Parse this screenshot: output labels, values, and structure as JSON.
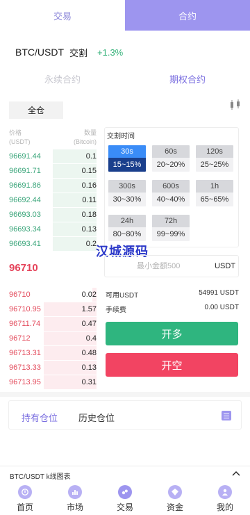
{
  "top_tabs": {
    "exchange": "交易",
    "contract": "合约"
  },
  "pair": {
    "name": "BTC/USDT",
    "type": "交割",
    "change": "+1.3%"
  },
  "contract_tabs": {
    "perpetual": "永续合约",
    "options": "期权合约"
  },
  "all_positions_label": "全仓",
  "orderbook": {
    "price_header": "价格",
    "price_unit": "(USDT)",
    "qty_header": "数量",
    "qty_unit": "(Bitcoin)",
    "buy_rows": [
      {
        "price": "96691.44",
        "qty": "0.1",
        "depth": 0.5
      },
      {
        "price": "96691.71",
        "qty": "0.15",
        "depth": 0.5
      },
      {
        "price": "96691.86",
        "qty": "0.16",
        "depth": 0.5
      },
      {
        "price": "96692.44",
        "qty": "0.11",
        "depth": 0.5
      },
      {
        "price": "96693.03",
        "qty": "0.18",
        "depth": 0.5
      },
      {
        "price": "96693.34",
        "qty": "0.13",
        "depth": 0.5
      },
      {
        "price": "96693.41",
        "qty": "0.2",
        "depth": 0.5
      }
    ],
    "last_price": "96710",
    "sell_rows": [
      {
        "price": "96710",
        "qty": "0.02",
        "depth": 0.05
      },
      {
        "price": "96710.95",
        "qty": "1.57",
        "depth": 0.6
      },
      {
        "price": "96711.74",
        "qty": "0.47",
        "depth": 0.6
      },
      {
        "price": "96712",
        "qty": "0.4",
        "depth": 0.6
      },
      {
        "price": "96713.31",
        "qty": "0.48",
        "depth": 0.6
      },
      {
        "price": "96713.33",
        "qty": "0.13",
        "depth": 0.6
      },
      {
        "price": "96713.95",
        "qty": "0.31",
        "depth": 0.6
      }
    ]
  },
  "delivery": {
    "title": "交割时间",
    "options": [
      {
        "time": "30s",
        "range": "15~15%",
        "selected": true
      },
      {
        "time": "60s",
        "range": "20~20%",
        "selected": false
      },
      {
        "time": "120s",
        "range": "25~25%",
        "selected": false
      },
      {
        "time": "300s",
        "range": "30~30%",
        "selected": false
      },
      {
        "time": "600s",
        "range": "40~40%",
        "selected": false
      },
      {
        "time": "1h",
        "range": "65~65%",
        "selected": false
      },
      {
        "time": "24h",
        "range": "80~80%",
        "selected": false
      },
      {
        "time": "72h",
        "range": "99~99%",
        "selected": false
      }
    ]
  },
  "watermark": "汉城源码",
  "amount": {
    "placeholder": "最小金额500",
    "unit": "USDT"
  },
  "available": {
    "label": "可用USDT",
    "value": "54991 USDT"
  },
  "fee": {
    "label": "手续费",
    "value": "0.00 USDT"
  },
  "buttons": {
    "long": "开多",
    "short": "开空"
  },
  "positions": {
    "holding": "持有仓位",
    "history": "历史仓位"
  },
  "kline_bar": {
    "label": "BTC/USDT k线图表"
  },
  "nav": [
    {
      "label": "首页",
      "icon": "home-icon",
      "active": false
    },
    {
      "label": "市场",
      "icon": "market-icon",
      "active": false
    },
    {
      "label": "交易",
      "icon": "trade-icon",
      "active": true
    },
    {
      "label": "资金",
      "icon": "wallet-icon",
      "active": false
    },
    {
      "label": "我的",
      "icon": "user-icon",
      "active": false
    }
  ],
  "colors": {
    "accent": "#9d95ef",
    "buy": "#2fb57f",
    "sell": "#f24462",
    "selected_time": "#3a8cf7"
  }
}
